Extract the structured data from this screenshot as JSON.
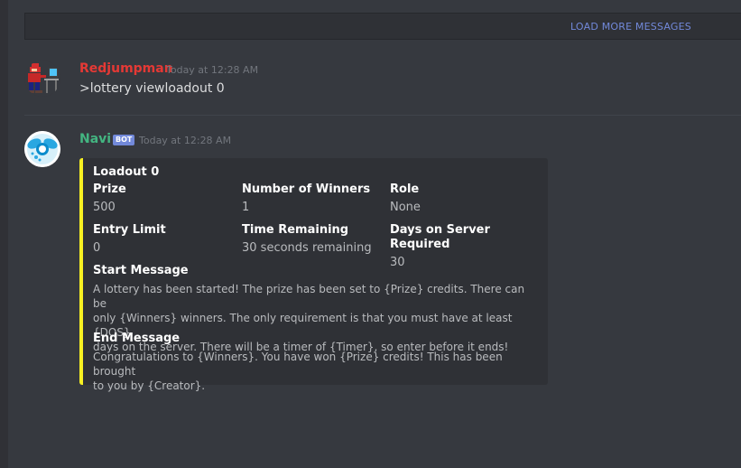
{
  "load_more": {
    "label": "LOAD MORE MESSAGES"
  },
  "messages": [
    {
      "author": "Redjumpman",
      "author_color": "#e53935",
      "timestamp": "Today at 12:28 AM",
      "content": ">lottery viewloadout 0",
      "avatar_icon": "pixel-character-icon"
    },
    {
      "author": "Navi",
      "author_color": "#43b581",
      "badge": "BOT",
      "timestamp": "Today at 12:28 AM",
      "avatar_icon": "navi-fairy-icon",
      "embed": {
        "color": "#f7f022",
        "title": "Loadout 0",
        "fields": [
          {
            "name": "Prize",
            "value": "500"
          },
          {
            "name": "Number of Winners",
            "value": "1"
          },
          {
            "name": "Role",
            "value": "None"
          },
          {
            "name": "Entry Limit",
            "value": "0"
          },
          {
            "name": "Time Remaining",
            "value": "30 seconds remaining"
          },
          {
            "name": "Days on Server Required",
            "value": "30"
          }
        ],
        "start_message": {
          "name": "Start Message",
          "lines": [
            "A lottery has been started! The prize has been set to {Prize} credits. There can be",
            "only {Winners} winners. The only requirement is that you must have at least {DOS}",
            "days on the server. There will be a timer of {Timer}, so enter before it ends!"
          ]
        },
        "end_message": {
          "name": "End Message",
          "lines": [
            "Congratulations to {Winners}. You have won {Prize} credits! This has been brought",
            "to you by {Creator}."
          ]
        }
      }
    }
  ]
}
